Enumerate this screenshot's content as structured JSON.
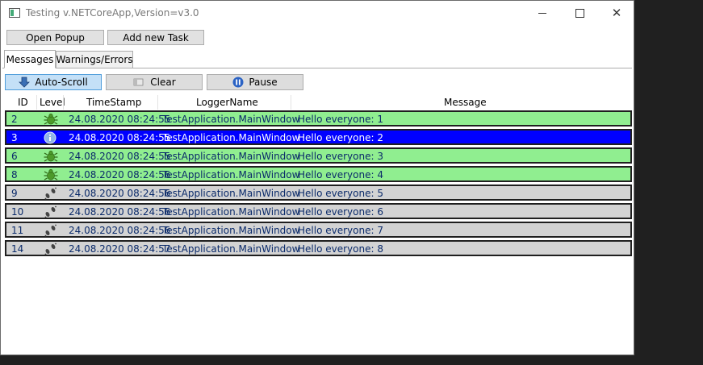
{
  "window": {
    "title": "Testing v.NETCoreApp,Version=v3.0"
  },
  "toolbar": {
    "open_popup": "Open Popup",
    "add_task": "Add new Task"
  },
  "tabs": [
    {
      "label": "Messages"
    },
    {
      "label": "Warnings/Errors"
    }
  ],
  "actions": {
    "autoscroll": "Auto-Scroll",
    "clear": "Clear",
    "pause": "Pause"
  },
  "columns": {
    "id": "ID",
    "level": "Level",
    "timestamp": "TimeStamp",
    "logger": "LoggerName",
    "message": "Message"
  },
  "colors": {
    "info": "#90ee90",
    "selected": "#0000ff",
    "debug": "#d3d3d3"
  },
  "rows": [
    {
      "id": "2",
      "level": "bug-icon",
      "timestamp": "24.08.2020 08:24:55",
      "logger": "TestApplication.MainWindow",
      "message": "Hello everyone: 1",
      "bg": "#90ee90"
    },
    {
      "id": "3",
      "level": "info-icon",
      "timestamp": "24.08.2020 08:24:55",
      "logger": "TestApplication.MainWindow",
      "message": "Hello everyone: 2",
      "bg": "#0000ff",
      "selected": true
    },
    {
      "id": "6",
      "level": "bug-icon",
      "timestamp": "24.08.2020 08:24:55",
      "logger": "TestApplication.MainWindow",
      "message": "Hello everyone: 3",
      "bg": "#90ee90"
    },
    {
      "id": "8",
      "level": "bug-icon",
      "timestamp": "24.08.2020 08:24:56",
      "logger": "TestApplication.MainWindow",
      "message": "Hello everyone: 4",
      "bg": "#90ee90"
    },
    {
      "id": "9",
      "level": "footprint-icon",
      "timestamp": "24.08.2020 08:24:56",
      "logger": "TestApplication.MainWindow",
      "message": "Hello everyone: 5",
      "bg": "#d3d3d3"
    },
    {
      "id": "10",
      "level": "footprint-icon",
      "timestamp": "24.08.2020 08:24:56",
      "logger": "TestApplication.MainWindow",
      "message": "Hello everyone: 6",
      "bg": "#d3d3d3"
    },
    {
      "id": "11",
      "level": "footprint-icon",
      "timestamp": "24.08.2020 08:24:56",
      "logger": "TestApplication.MainWindow",
      "message": "Hello everyone: 7",
      "bg": "#d3d3d3"
    },
    {
      "id": "14",
      "level": "footprint-icon",
      "timestamp": "24.08.2020 08:24:57",
      "logger": "TestApplication.MainWindow",
      "message": "Hello everyone: 8",
      "bg": "#d3d3d3"
    }
  ]
}
